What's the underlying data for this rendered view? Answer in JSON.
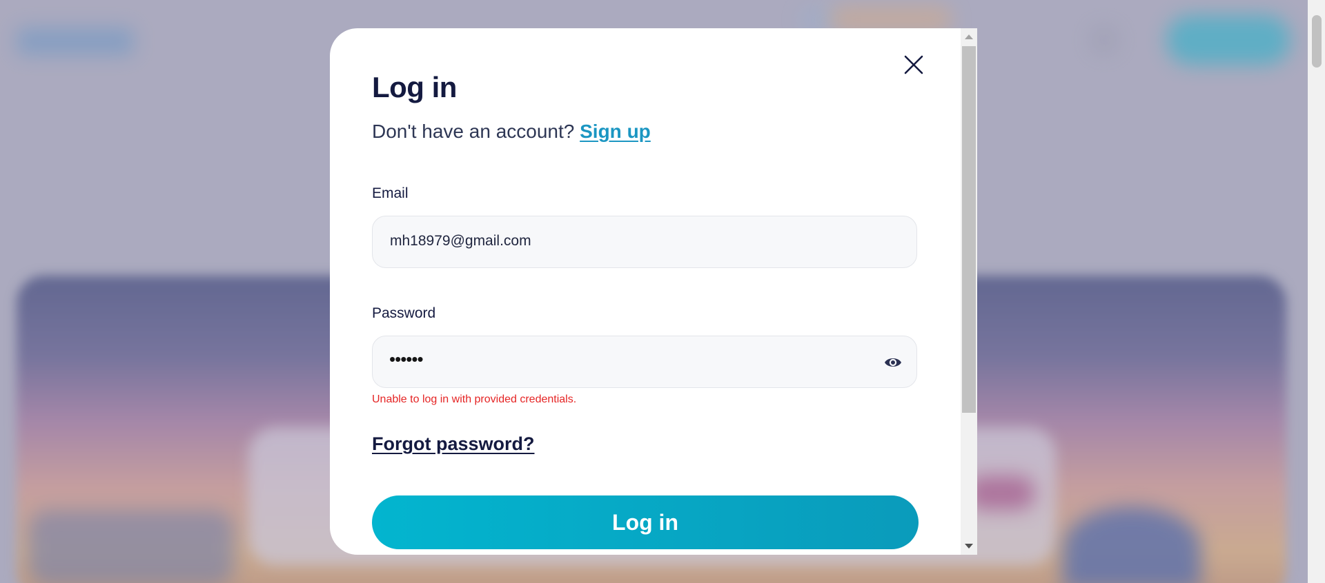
{
  "modal": {
    "title": "Log in",
    "subtitle_text": "Don't have an account?",
    "signup_link": "Sign up",
    "email": {
      "label": "Email",
      "value": "mh18979@gmail.com"
    },
    "password": {
      "label": "Password",
      "masked_value": "••••••"
    },
    "error_message": "Unable to log in with provided credentials.",
    "forgot_link": "Forgot password?",
    "login_button": "Log in"
  },
  "icons": {
    "close": "close-icon",
    "eye": "eye-icon"
  },
  "colors": {
    "accent": "#03b5cf",
    "link": "#1b96c2",
    "error": "#e52424",
    "heading": "#141a40"
  }
}
